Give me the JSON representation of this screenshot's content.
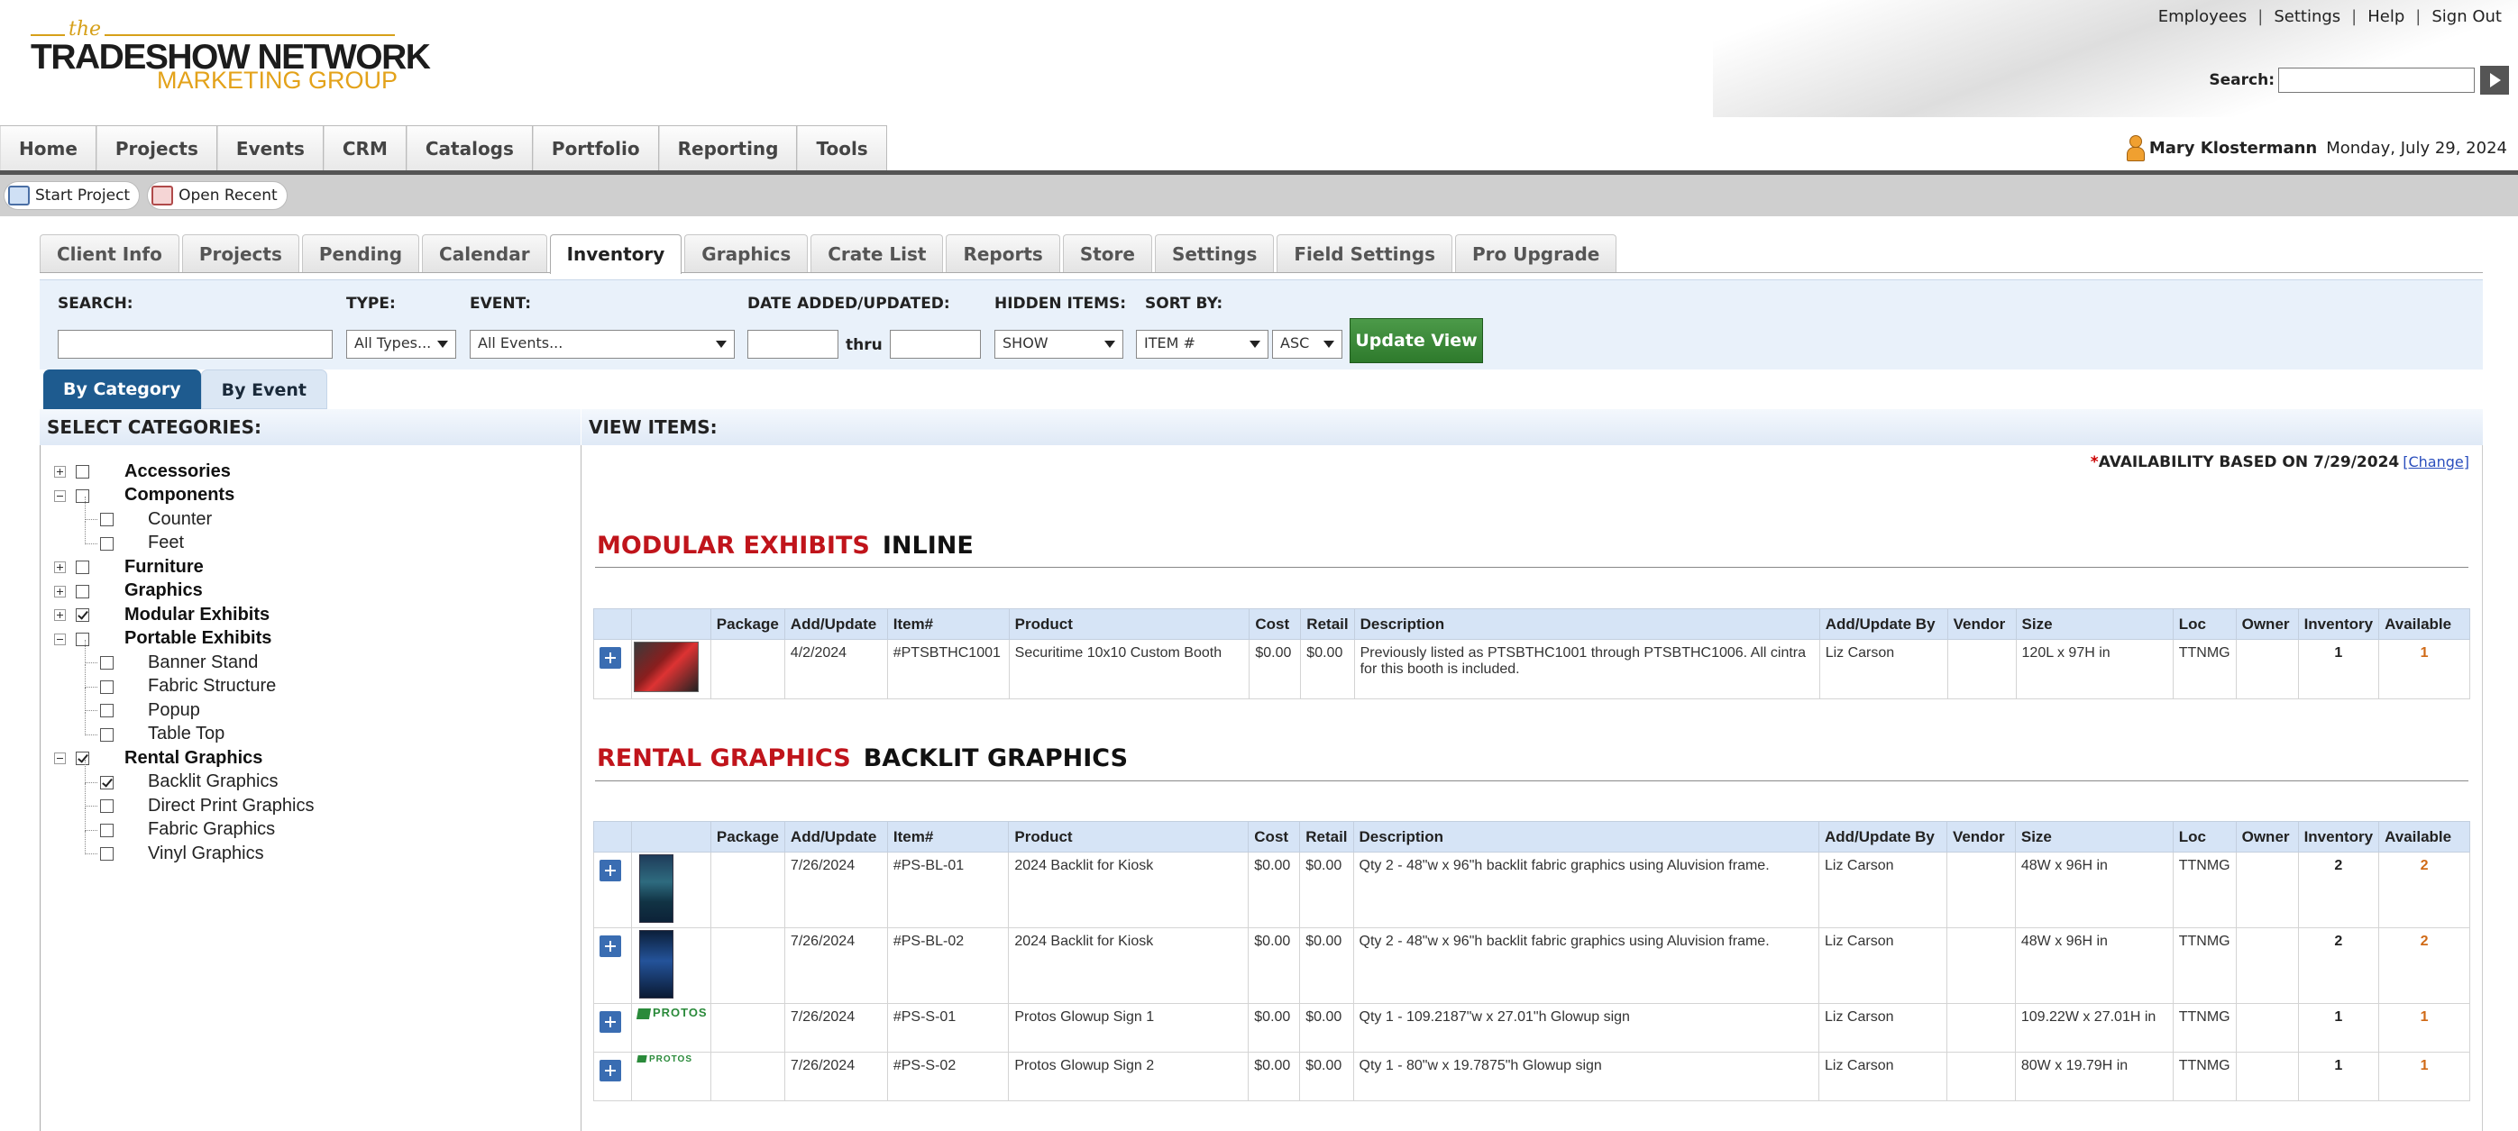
{
  "header": {
    "logo": {
      "line1": "the",
      "line2": "TRADESHOW NETWORK",
      "line3": "MARKETING GROUP"
    },
    "top_links": [
      "Employees",
      "Settings",
      "Help",
      "Sign Out"
    ],
    "search_label": "Search:",
    "search_value": ""
  },
  "main_nav": [
    "Home",
    "Projects",
    "Events",
    "CRM",
    "Catalogs",
    "Portfolio",
    "Reporting",
    "Tools"
  ],
  "user": {
    "name": "Mary Klostermann",
    "date": "Monday, July 29, 2024"
  },
  "toolbar": {
    "start_project": "Start Project",
    "open_recent": "Open Recent"
  },
  "sub_tabs": [
    "Client Info",
    "Projects",
    "Pending",
    "Calendar",
    "Inventory",
    "Graphics",
    "Crate List",
    "Reports",
    "Store",
    "Settings",
    "Field Settings",
    "Pro Upgrade"
  ],
  "active_sub_tab": "Inventory",
  "filters": {
    "search_label": "SEARCH:",
    "search_value": "",
    "type_label": "TYPE:",
    "type_value": "All Types...",
    "event_label": "EVENT:",
    "event_value": "All Events...",
    "date_label": "DATE ADDED/UPDATED:",
    "date_from": "",
    "thru": "thru",
    "date_to": "",
    "hidden_label": "HIDDEN ITEMS:",
    "hidden_value": "SHOW",
    "sort_label": "SORT BY:",
    "sort_value": "ITEM #",
    "sort_dir": "ASC",
    "update_button": "Update View"
  },
  "view_tabs": [
    "By Category",
    "By Event"
  ],
  "categories_title": "SELECT CATEGORIES:",
  "items_title": "VIEW ITEMS:",
  "categories": [
    {
      "label": "Accessories",
      "level": 0,
      "checked": false,
      "expand": "plus"
    },
    {
      "label": "Components",
      "level": 0,
      "checked": false,
      "expand": "minus"
    },
    {
      "label": "Counter",
      "level": 1,
      "checked": false
    },
    {
      "label": "Feet",
      "level": 1,
      "checked": false
    },
    {
      "label": "Furniture",
      "level": 0,
      "checked": false,
      "expand": "plus"
    },
    {
      "label": "Graphics",
      "level": 0,
      "checked": false,
      "expand": "plus"
    },
    {
      "label": "Modular Exhibits",
      "level": 0,
      "checked": true,
      "expand": "plus"
    },
    {
      "label": "Portable Exhibits",
      "level": 0,
      "checked": false,
      "expand": "minus"
    },
    {
      "label": "Banner Stand",
      "level": 1,
      "checked": false
    },
    {
      "label": "Fabric Structure",
      "level": 1,
      "checked": false
    },
    {
      "label": "Popup",
      "level": 1,
      "checked": false
    },
    {
      "label": "Table Top",
      "level": 1,
      "checked": false
    },
    {
      "label": "Rental Graphics",
      "level": 0,
      "checked": true,
      "expand": "minus"
    },
    {
      "label": "Backlit Graphics",
      "level": 1,
      "checked": true
    },
    {
      "label": "Direct Print Graphics",
      "level": 1,
      "checked": false
    },
    {
      "label": "Fabric Graphics",
      "level": 1,
      "checked": false
    },
    {
      "label": "Vinyl Graphics",
      "level": 1,
      "checked": false
    }
  ],
  "availability": {
    "star": "*",
    "text": "AVAILABILITY BASED ON 7/29/2024",
    "change": "[Change]"
  },
  "columns": [
    "",
    "",
    "Package",
    "Add/Update",
    "Item#",
    "Product",
    "Cost",
    "Retail",
    "Description",
    "Add/Update By",
    "Vendor",
    "Size",
    "Loc",
    "Owner",
    "Inventory",
    "Available"
  ],
  "groups": [
    {
      "category": "MODULAR EXHIBITS",
      "subcategory": "INLINE",
      "rows": [
        {
          "thumb": "booth",
          "package": "",
          "date": "4/2/2024",
          "item": "#PTSBTHC1001",
          "product": "Securitime 10x10 Custom Booth",
          "cost": "$0.00",
          "retail": "$0.00",
          "description": "Previously listed as PTSBTHC1001 through PTSBTHC1006. All cintra for this booth is included.",
          "by": "Liz Carson",
          "vendor": "",
          "size": "120L x 97H in",
          "loc": "TTNMG",
          "owner": "",
          "inventory": "1",
          "available": "1"
        }
      ]
    },
    {
      "category": "RENTAL GRAPHICS",
      "subcategory": "BACKLIT GRAPHICS",
      "rows": [
        {
          "thumb": "backlit1",
          "package": "",
          "date": "7/26/2024",
          "item": "#PS-BL-01",
          "product": "2024 Backlit for Kiosk",
          "cost": "$0.00",
          "retail": "$0.00",
          "description": "Qty 2 - 48\"w x 96\"h backlit fabric graphics using Aluvision frame.",
          "by": "Liz Carson",
          "vendor": "",
          "size": "48W x 96H in",
          "loc": "TTNMG",
          "owner": "",
          "inventory": "2",
          "available": "2"
        },
        {
          "thumb": "backlit2",
          "package": "",
          "date": "7/26/2024",
          "item": "#PS-BL-02",
          "product": "2024 Backlit for Kiosk",
          "cost": "$0.00",
          "retail": "$0.00",
          "description": "Qty 2 - 48\"w x 96\"h backlit fabric graphics using Aluvision frame.",
          "by": "Liz Carson",
          "vendor": "",
          "size": "48W x 96H in",
          "loc": "TTNMG",
          "owner": "",
          "inventory": "2",
          "available": "2"
        },
        {
          "thumb": "protos",
          "thumb_text": "PROTOS",
          "package": "",
          "date": "7/26/2024",
          "item": "#PS-S-01",
          "product": "Protos Glowup Sign 1",
          "cost": "$0.00",
          "retail": "$0.00",
          "description": "Qty 1 - 109.2187\"w x 27.01\"h Glowup sign",
          "by": "Liz Carson",
          "vendor": "",
          "size": "109.22W x 27.01H in",
          "loc": "TTNMG",
          "owner": "",
          "inventory": "1",
          "available": "1"
        },
        {
          "thumb": "protos-sm",
          "thumb_text": "PROTOS",
          "package": "",
          "date": "7/26/2024",
          "item": "#PS-S-02",
          "product": "Protos Glowup Sign 2",
          "cost": "$0.00",
          "retail": "$0.00",
          "description": "Qty 1 - 80\"w x 19.7875\"h Glowup sign",
          "by": "Liz Carson",
          "vendor": "",
          "size": "80W x 19.79H in",
          "loc": "TTNMG",
          "owner": "",
          "inventory": "1",
          "available": "1"
        }
      ]
    }
  ],
  "colors": {
    "accent_red": "#c0141b",
    "nav_blue": "#1e5b8f",
    "update_green": "#3a8a37",
    "available_orange": "#d06a17",
    "logo_gold": "#e3a21a"
  }
}
